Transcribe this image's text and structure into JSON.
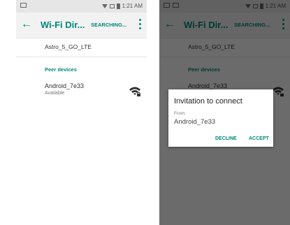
{
  "status_bar": {
    "time": "1:21 AM"
  },
  "app_bar": {
    "title": "Wi-Fi Dir...",
    "searching": "SEARCHING..."
  },
  "connected_device": {
    "name": "Astro_5_GO_LTE"
  },
  "peer_section": {
    "header": "Peer devices"
  },
  "peer_device": {
    "name": "Android_7e33",
    "status": "Available",
    "icon": "wifi-lock-icon"
  },
  "dialog": {
    "title": "Invitation to connect",
    "from_label": "From:",
    "device_name": "Android_7e33",
    "decline_label": "DECLINE",
    "accept_label": "ACCEPT"
  },
  "colors": {
    "accent": "#00897b",
    "dim_overlay": "#000000"
  }
}
